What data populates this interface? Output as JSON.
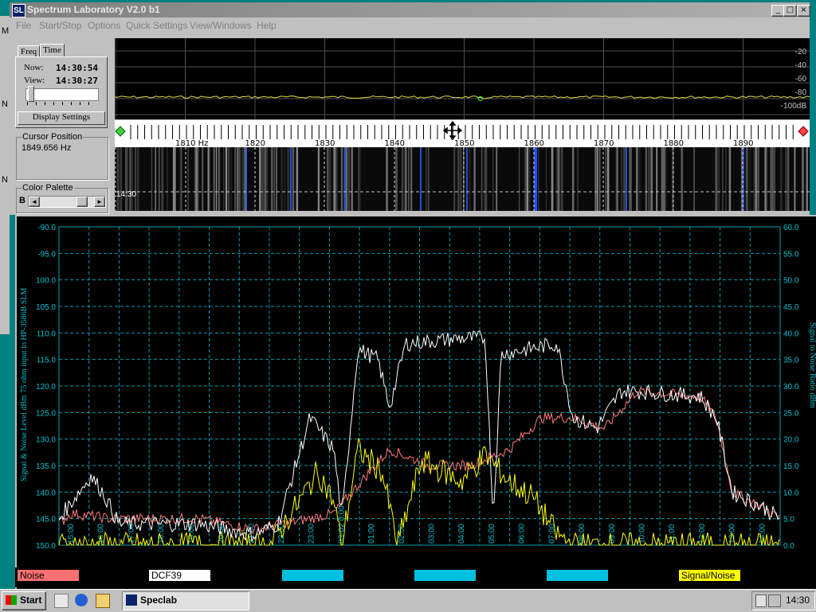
{
  "window": {
    "title": "Spectrum Laboratory V2.0 b1",
    "app_icon": "SL",
    "minimize": "_",
    "maximize": "□",
    "close": "×"
  },
  "menu": [
    "File",
    "Start/Stop",
    "Options",
    "Quick Settings",
    "View/Windows",
    "Help"
  ],
  "side_letters": [
    "M",
    "N",
    "N"
  ],
  "left_panel": {
    "tabs": [
      "Freq",
      "Time"
    ],
    "now_label": "Now:",
    "now_value": "14:30:54",
    "view_label": "View:",
    "view_value": "14:30:27",
    "display_settings": "Display Settings",
    "cursor_title": "Cursor Position",
    "cursor_value": "1849.656 Hz",
    "palette_title": "Color Palette",
    "palette_letter": "B",
    "scroll_left": "◄",
    "scroll_right": "►"
  },
  "spectrum": {
    "db_labels": [
      "-20",
      "-40",
      "-60",
      "-80",
      "-100dB"
    ],
    "freq_labels": [
      "1810 Hz",
      "1820",
      "1830",
      "1840",
      "1850",
      "1860",
      "1870",
      "1880",
      "1890"
    ],
    "waterfall_time": "14:30"
  },
  "plot": {
    "left_axis_title": "Signal & Noise Level  dBm 75 ohm input to HP-3586B SLM",
    "right_axis_title": "Signal to Noise Ratio   dBm",
    "left_ticks": [
      "-90.0",
      "-95.0",
      "100.0",
      "105.0",
      "110.0",
      "115.0",
      "120.0",
      "125.0",
      "130.0",
      "135.0",
      "140.0",
      "145.0",
      "150.0"
    ],
    "right_ticks": [
      "60.0",
      "55.0",
      "50.0",
      "45.0",
      "40.0",
      "35.0",
      "30.0",
      "25.0",
      "20.0",
      "15.0",
      "10.0",
      "5.0",
      "0.0"
    ],
    "time_labels": [
      "15:00",
      "16:00",
      "17:00",
      "18:00",
      "19:00",
      "20:00",
      "21:00",
      "22:00",
      "23:00",
      "03-02 0:00",
      "01:00",
      "02:00",
      "03:00",
      "04:00",
      "05:00",
      "06:00",
      "07:00",
      "08:00",
      "09:00",
      "10:00",
      "11:00",
      "12:00",
      "13:00",
      "14:00"
    ],
    "colors": {
      "grid": "#00a0b0",
      "axis_text": "#00c0d0",
      "noise": "#ff7070",
      "dcf39": "#ffffff",
      "snr": "#ffff00"
    }
  },
  "legend": {
    "noise": "Noise",
    "dcf39": "DCF39",
    "snr": "Signal/Noise"
  },
  "taskbar": {
    "start": "Start",
    "app": "Speclab",
    "clock": "14:30"
  }
}
